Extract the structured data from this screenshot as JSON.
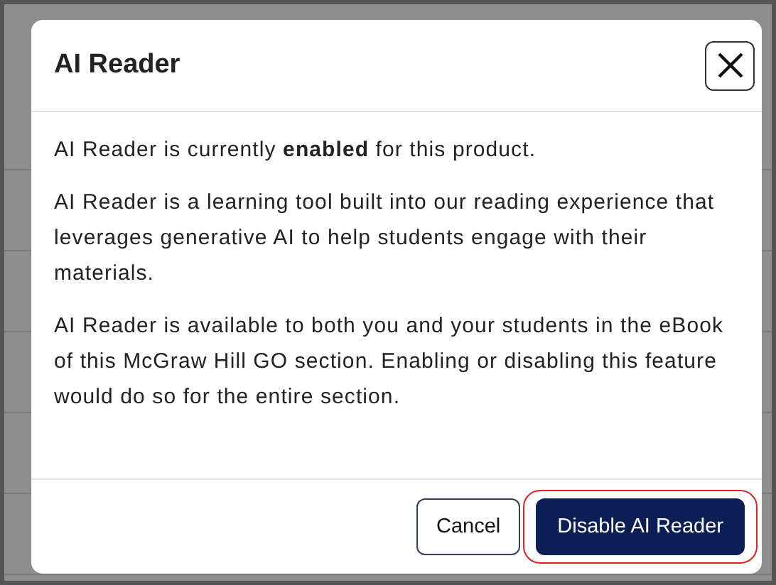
{
  "dialog": {
    "title": "AI Reader",
    "paragraphs": [
      "AI Reader is currently **enabled** for this product.",
      "AI Reader is a learning tool built into our reading experience that leverages generative AI to help students engage with their materials.",
      "AI Reader is available to both you and your students in the eBook of this McGraw Hill GO section. Enabling or disabling this feature would do so for the entire section."
    ],
    "buttons": [
      {
        "label": "Cancel",
        "kind": "secondary",
        "highlighted": false
      },
      {
        "label": "Disable AI Reader",
        "kind": "primary",
        "highlighted": true
      }
    ]
  }
}
